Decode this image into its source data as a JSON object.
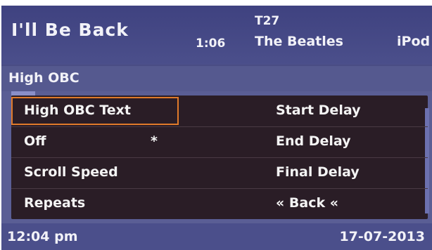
{
  "now_playing": {
    "title": "I'll Be Back",
    "elapsed": "1:06",
    "track_number": "T27",
    "artist": "The Beatles",
    "source": "iPod"
  },
  "menu": {
    "title": "High OBC",
    "rows": [
      {
        "left": "High OBC Text",
        "marker": "",
        "right": "Start Delay"
      },
      {
        "left": "Off",
        "marker": "*",
        "right": "End Delay"
      },
      {
        "left": "Scroll Speed",
        "marker": "",
        "right": "Final Delay"
      },
      {
        "left": "Repeats",
        "marker": "",
        "right": "« Back «"
      }
    ],
    "selected_index": 0
  },
  "status": {
    "time": "12:04 pm",
    "date": "17-07-2013"
  },
  "colors": {
    "background": "#4a4d84",
    "panel": "#2a1d26",
    "selection": "#e07a2a",
    "text": "#f2f2f8"
  }
}
